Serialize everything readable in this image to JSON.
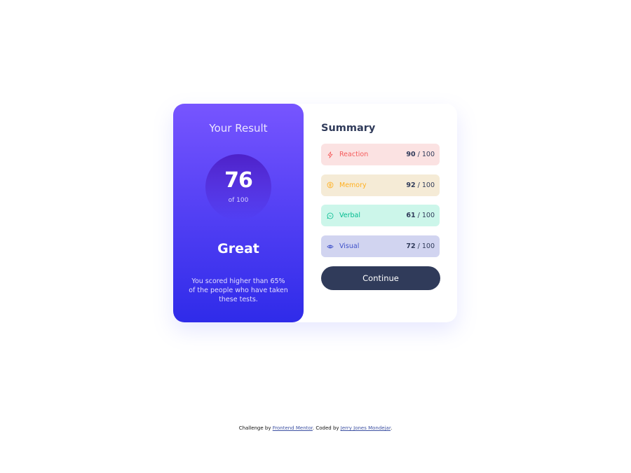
{
  "result": {
    "title": "Your Result",
    "score": "76",
    "of_label": "of 100",
    "grade": "Great",
    "description": "You scored higher than 65% of the people who have taken these tests."
  },
  "summary": {
    "title": "Summary",
    "rows": [
      {
        "label": "Reaction",
        "value": "90",
        "max": "100",
        "icon": "lightning-icon",
        "color": "#f55b5b",
        "bg": "#fbe2e2"
      },
      {
        "label": "Memory",
        "value": "92",
        "max": "100",
        "icon": "brain-icon",
        "color": "#ffb021",
        "bg": "#f5ebd6"
      },
      {
        "label": "Verbal",
        "value": "61",
        "max": "100",
        "icon": "chat-icon",
        "color": "#00bb8f",
        "bg": "#ccf6ea"
      },
      {
        "label": "Visual",
        "value": "72",
        "max": "100",
        "icon": "eye-icon",
        "color": "#3e50c9",
        "bg": "#d1d4f0"
      }
    ],
    "separator": "/",
    "continue_label": "Continue"
  },
  "attribution": {
    "prefix": "Challenge by ",
    "link1": "Frontend Mentor",
    "middle": ". Coded by ",
    "link2": "Jerry Jones Mondejar",
    "suffix": "."
  },
  "colors": {
    "gradient_top": "#7755ff",
    "gradient_bottom": "#2f2be9",
    "dark_navy": "#303b5a"
  }
}
